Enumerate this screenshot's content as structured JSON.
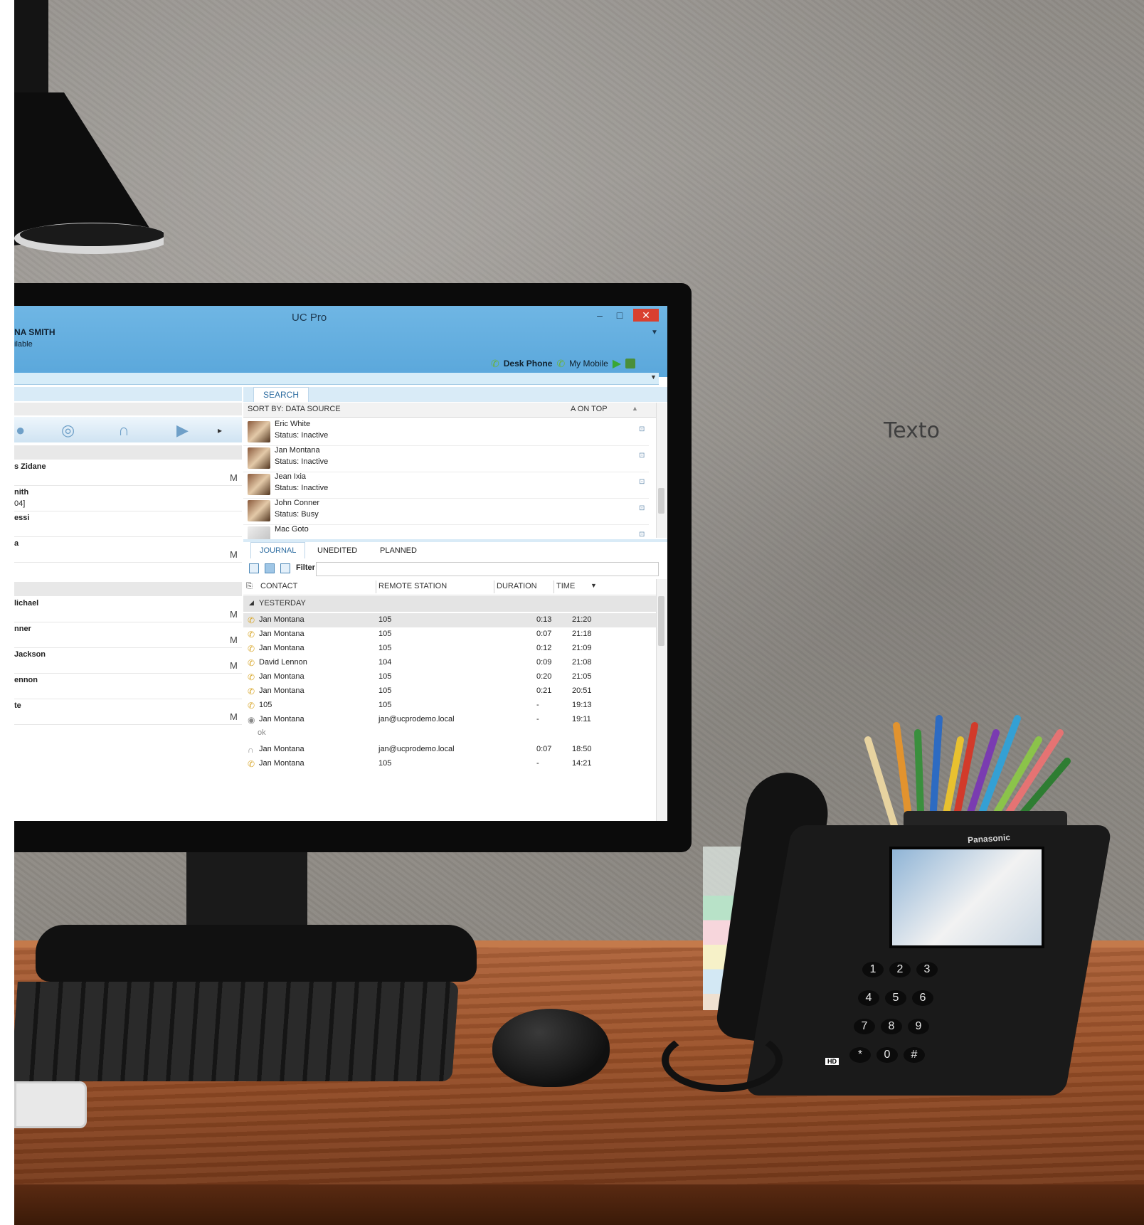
{
  "texto_label": "Texto",
  "app": {
    "title": "UC Pro",
    "user": {
      "name": "NA SMITH",
      "status": "ilable"
    },
    "window_buttons": {
      "minimize": "–",
      "maximize": "□",
      "close": "✕"
    },
    "devices": {
      "desk_phone": "Desk Phone",
      "my_mobile": "My Mobile"
    },
    "colors": {
      "titlebar": "#5aa7db",
      "close": "#d9402f",
      "accent": "#2d6ca0",
      "call_icon": "#d8a526"
    }
  },
  "left_pane": {
    "contacts": [
      {
        "name": "s Zidane",
        "sub": "",
        "marker": "M"
      },
      {
        "name": "nith",
        "sub": "04]",
        "marker": ""
      },
      {
        "name": "essi",
        "sub": "",
        "marker": ""
      },
      {
        "name": "a",
        "sub": "",
        "marker": "M"
      },
      {
        "name": "lichael",
        "sub": "",
        "marker": "M"
      },
      {
        "name": "nner",
        "sub": "",
        "marker": "M"
      },
      {
        "name": "Jackson",
        "sub": "",
        "marker": "M"
      },
      {
        "name": "ennon",
        "sub": "",
        "marker": ""
      },
      {
        "name": "te",
        "sub": "",
        "marker": "M"
      }
    ]
  },
  "search": {
    "tab_label": "SEARCH",
    "sort_label": "SORT BY: DATA SOURCE",
    "sort_option": "A ON TOP",
    "results": [
      {
        "name": "Eric White",
        "status": "Status: Inactive"
      },
      {
        "name": "Jan Montana",
        "status": "Status: Inactive"
      },
      {
        "name": "Jean Ixia",
        "status": "Status: Inactive"
      },
      {
        "name": "John Conner",
        "status": "Status: Busy"
      },
      {
        "name": "Mac Goto",
        "status": ""
      }
    ]
  },
  "journal": {
    "tabs": [
      "JOURNAL",
      "UNEDITED",
      "PLANNED"
    ],
    "filter_label": "Filter",
    "columns": [
      "CONTACT",
      "REMOTE STATION",
      "DURATION",
      "TIME"
    ],
    "group": "YESTERDAY",
    "rows": [
      {
        "contact": "Jan Montana",
        "station": "105",
        "duration": "0:13",
        "time": "21:20",
        "icon": "call"
      },
      {
        "contact": "Jan Montana",
        "station": "105",
        "duration": "0:07",
        "time": "21:18",
        "icon": "call"
      },
      {
        "contact": "Jan Montana",
        "station": "105",
        "duration": "0:12",
        "time": "21:09",
        "icon": "call"
      },
      {
        "contact": "David Lennon",
        "station": "104",
        "duration": "0:09",
        "time": "21:08",
        "icon": "call"
      },
      {
        "contact": "Jan Montana",
        "station": "105",
        "duration": "0:20",
        "time": "21:05",
        "icon": "call"
      },
      {
        "contact": "Jan Montana",
        "station": "105",
        "duration": "0:21",
        "time": "20:51",
        "icon": "call"
      },
      {
        "contact": "105",
        "station": "105",
        "duration": "-",
        "time": "19:13",
        "icon": "call"
      },
      {
        "contact": "Jan Montana",
        "station": "jan@ucprodemo.local",
        "duration": "-",
        "time": "19:11",
        "icon": "chat"
      },
      {
        "contact": "Jan Montana",
        "station": "jan@ucprodemo.local",
        "duration": "0:07",
        "time": "18:50",
        "icon": "headset"
      },
      {
        "contact": "Jan Montana",
        "station": "105",
        "duration": "-",
        "time": "14:21",
        "icon": "call"
      }
    ],
    "note": "ok"
  },
  "phone": {
    "brand": "Panasonic",
    "keys": [
      "1",
      "2",
      "3",
      "4",
      "5",
      "6",
      "7",
      "8",
      "9",
      "*",
      "0",
      "#"
    ],
    "badge": "HD"
  }
}
